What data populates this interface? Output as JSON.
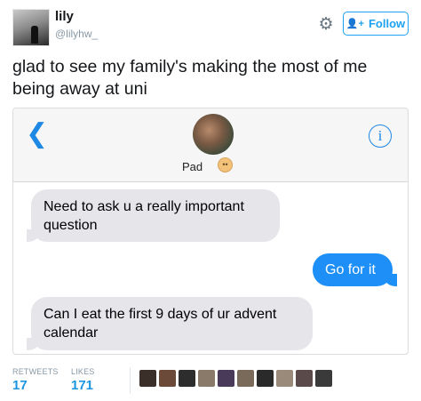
{
  "tweet": {
    "display_name": "lily",
    "handle": "@lilyhw_",
    "follow_label": "Follow",
    "text": "glad to see my family's making the most of me being away at uni"
  },
  "imessage": {
    "contact_name": "Pad",
    "contact_emoji_icon": "baby-face-emoji-icon",
    "messages": [
      {
        "side": "received",
        "text": "Need to ask u a really important question"
      },
      {
        "side": "sent",
        "text": "Go for it"
      },
      {
        "side": "received",
        "text": "Can I eat the first 9 days of ur advent calendar"
      }
    ],
    "colors": {
      "sent_bubble": "#1e8ff7",
      "received_bubble": "#e5e5ea",
      "accent": "#1e88e5"
    }
  },
  "stats": {
    "retweets_label": "RETWEETS",
    "retweets_count": "17",
    "likes_label": "LIKES",
    "likes_count": "171"
  },
  "likers": [
    {
      "color": "#3b2f2a"
    },
    {
      "color": "#6b4a3a"
    },
    {
      "color": "#2d2d2d"
    },
    {
      "color": "#8a7a6a"
    },
    {
      "color": "#4a3a5a"
    },
    {
      "color": "#7a6a5a"
    },
    {
      "color": "#2a2a2a"
    },
    {
      "color": "#9a8a7a"
    },
    {
      "color": "#5a4a4a"
    },
    {
      "color": "#3a3a3a"
    }
  ]
}
